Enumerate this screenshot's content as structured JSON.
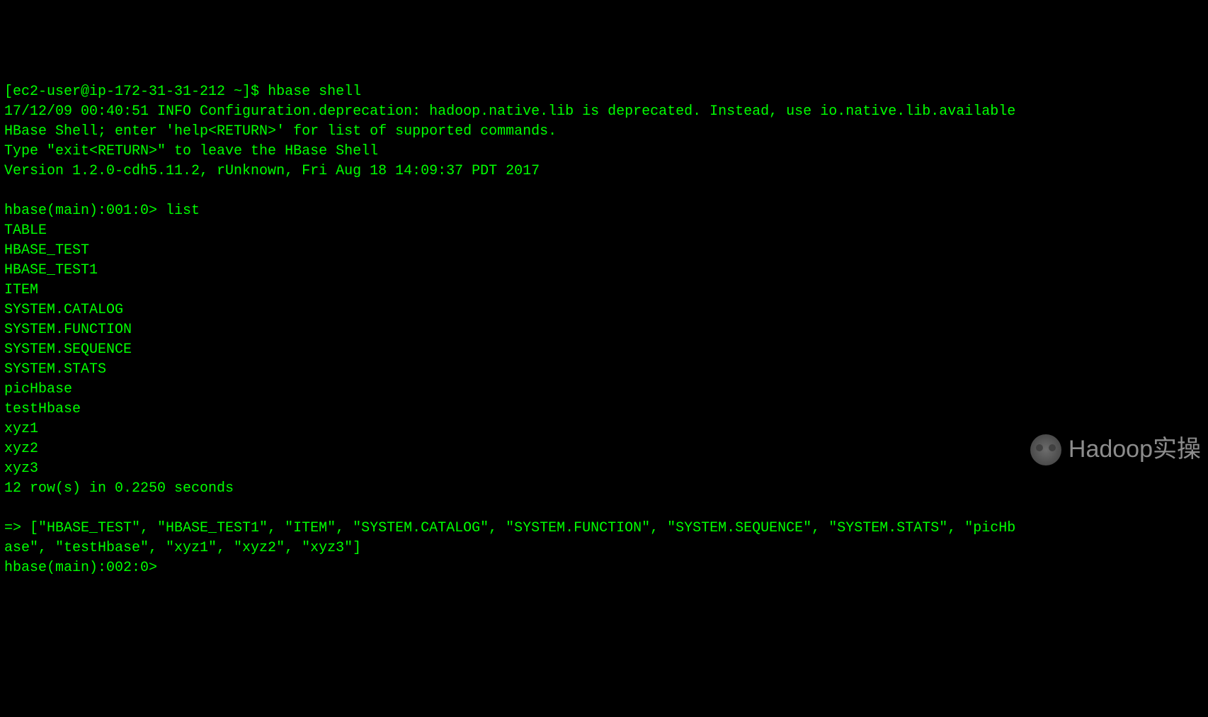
{
  "shell": {
    "prompt_user": "[ec2-user@ip-172-31-31-212 ~]$ ",
    "command": "hbase shell",
    "info_line": "17/12/09 00:40:51 INFO Configuration.deprecation: hadoop.native.lib is deprecated. Instead, use io.native.lib.available",
    "help_line": "HBase Shell; enter 'help<RETURN>' for list of supported commands.",
    "exit_line": "Type \"exit<RETURN>\" to leave the HBase Shell",
    "version_line": "Version 1.2.0-cdh5.11.2, rUnknown, Fri Aug 18 14:09:37 PDT 2017",
    "blank": "",
    "hbase_prompt1": "hbase(main):001:0> ",
    "list_cmd": "list",
    "table_header": "TABLE",
    "tables": [
      "HBASE_TEST",
      "HBASE_TEST1",
      "ITEM",
      "SYSTEM.CATALOG",
      "SYSTEM.FUNCTION",
      "SYSTEM.SEQUENCE",
      "SYSTEM.STATS",
      "picHbase",
      "testHbase",
      "xyz1",
      "xyz2",
      "xyz3"
    ],
    "row_count_line": "12 row(s) in 0.2250 seconds",
    "result_line1": "=> [\"HBASE_TEST\", \"HBASE_TEST1\", \"ITEM\", \"SYSTEM.CATALOG\", \"SYSTEM.FUNCTION\", \"SYSTEM.SEQUENCE\", \"SYSTEM.STATS\", \"picHb",
    "result_line2": "ase\", \"testHbase\", \"xyz1\", \"xyz2\", \"xyz3\"]",
    "hbase_prompt2": "hbase(main):002:0>"
  },
  "watermark": {
    "text": "Hadoop实操"
  }
}
